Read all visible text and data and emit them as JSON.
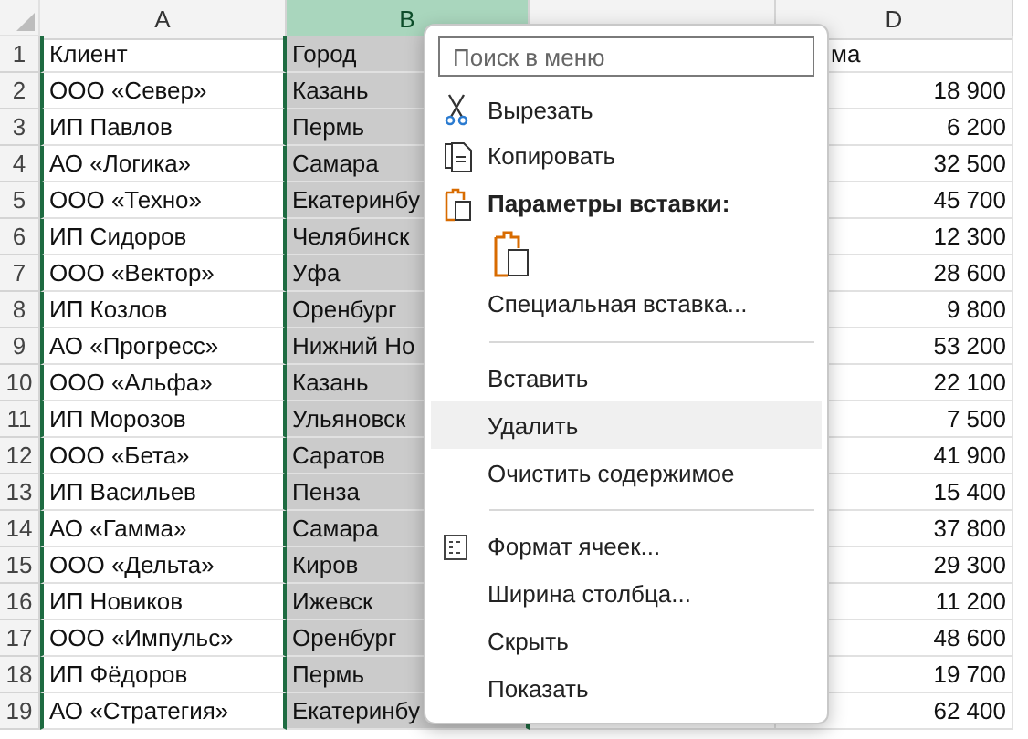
{
  "columns": [
    {
      "label": "A",
      "selected": false
    },
    {
      "label": "B",
      "selected": true
    },
    {
      "selected": false
    },
    {
      "label": "D",
      "selected": false
    }
  ],
  "rows": [
    {
      "number": "1",
      "kind": "header",
      "client": "Клиент",
      "city": "Город",
      "column_4": "ма"
    },
    {
      "number": "2",
      "kind": "data",
      "client": "ООО «Север»",
      "city": "Казань",
      "column_4": "18 900"
    },
    {
      "number": "3",
      "kind": "data",
      "client": "ИП Павлов",
      "city": "Пермь",
      "column_4": "6 200"
    },
    {
      "number": "4",
      "kind": "data",
      "client": "АО «Логика»",
      "city": "Самара",
      "column_4": "32 500"
    },
    {
      "number": "5",
      "kind": "data",
      "client": "ООО «Техно»",
      "city": "Екатеринбу",
      "column_4": "45 700"
    },
    {
      "number": "6",
      "kind": "data",
      "client": "ИП Сидоров",
      "city": "Челябинск",
      "column_4": "12 300"
    },
    {
      "number": "7",
      "kind": "data",
      "client": "ООО «Вектор»",
      "city": "Уфа",
      "column_4": "28 600"
    },
    {
      "number": "8",
      "kind": "data",
      "client": "ИП Козлов",
      "city": "Оренбург",
      "column_4": "9 800"
    },
    {
      "number": "9",
      "kind": "data",
      "client": "АО «Прогресс»",
      "city": "Нижний Но",
      "column_4": "53 200"
    },
    {
      "number": "10",
      "kind": "data",
      "client": "ООО «Альфа»",
      "city": "Казань",
      "column_4": "22 100"
    },
    {
      "number": "11",
      "kind": "data",
      "client": "ИП Морозов",
      "city": "Ульяновск",
      "column_4": "7 500"
    },
    {
      "number": "12",
      "kind": "data",
      "client": "ООО «Бета»",
      "city": "Саратов",
      "column_4": "41 900"
    },
    {
      "number": "13",
      "kind": "data",
      "client": "ИП Васильев",
      "city": "Пенза",
      "column_4": "15 400"
    },
    {
      "number": "14",
      "kind": "data",
      "client": "АО «Гамма»",
      "city": "Самара",
      "column_4": "37 800"
    },
    {
      "number": "15",
      "kind": "data",
      "client": "ООО «Дельта»",
      "city": "Киров",
      "column_4": "29 300"
    },
    {
      "number": "16",
      "kind": "data",
      "client": "ИП Новиков",
      "city": "Ижевск",
      "column_4": "11 200"
    },
    {
      "number": "17",
      "kind": "data",
      "client": "ООО «Импульс»",
      "city": "Оренбург",
      "column_4": "48 600"
    },
    {
      "number": "18",
      "kind": "data",
      "client": "ИП Фёдоров",
      "city": "Пермь",
      "column_4": "19 700"
    },
    {
      "number": "19",
      "kind": "data",
      "client": "АО «Стратегия»",
      "city": "Екатеринбу",
      "column_4": "62 400"
    }
  ],
  "context_menu": {
    "search": {
      "placeholder": "Поиск в меню"
    },
    "items": [
      {
        "kind": "cut",
        "label": "Вырезать",
        "selected": false
      },
      {
        "kind": "copy",
        "label": "Копировать",
        "selected": false
      },
      {
        "kind": "header",
        "label": "Параметры вставки:"
      },
      {
        "kind": "paste_options"
      },
      {
        "kind": "item",
        "label": "Специальная вставка...",
        "selected": false
      },
      {
        "kind": "separator"
      },
      {
        "kind": "item",
        "label": "Вставить",
        "selected": false
      },
      {
        "kind": "item",
        "label": "Удалить",
        "selected": true
      },
      {
        "kind": "item",
        "label": "Очистить содержимое",
        "selected": false
      },
      {
        "kind": "separator"
      },
      {
        "kind": "format",
        "label": "Формат ячеек...",
        "selected": false
      },
      {
        "kind": "item",
        "label": "Ширина столбца...",
        "selected": false
      },
      {
        "kind": "item",
        "label": "Скрыть",
        "selected": false
      },
      {
        "kind": "item",
        "label": "Показать",
        "selected": false
      }
    ]
  }
}
